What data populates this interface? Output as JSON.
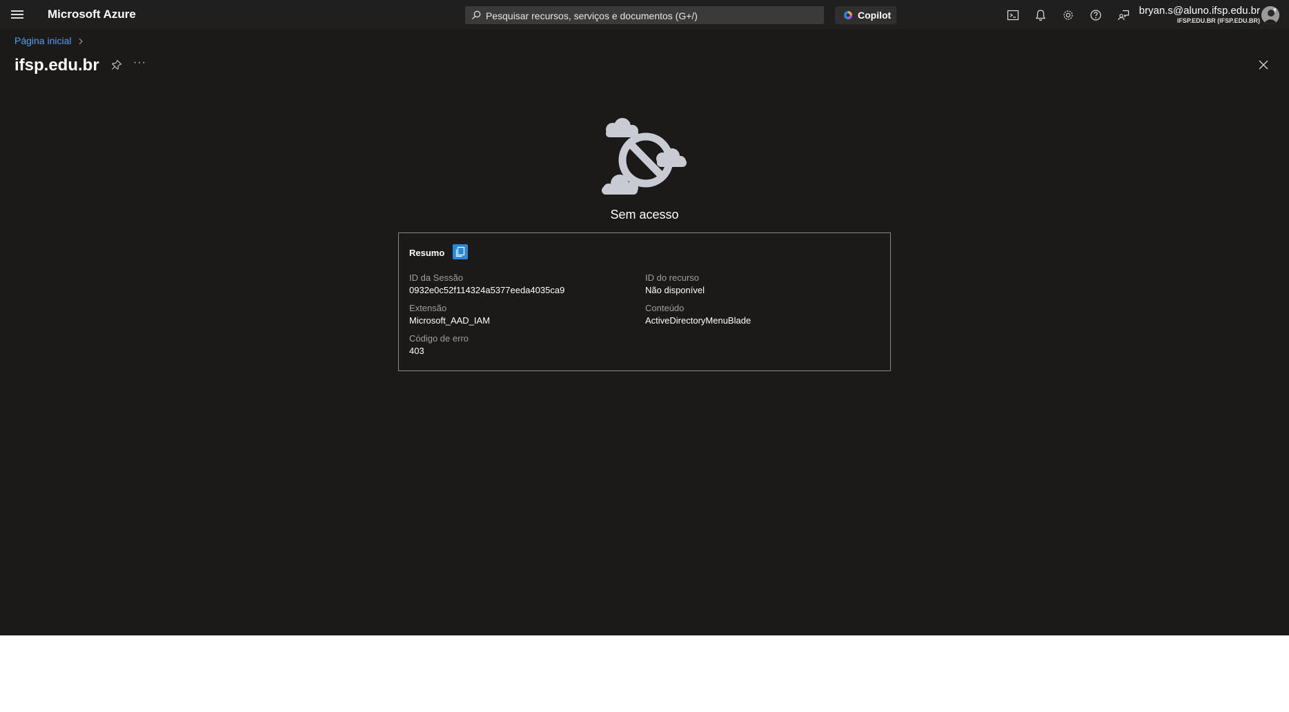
{
  "header": {
    "brand": "Microsoft Azure",
    "search_placeholder": "Pesquisar recursos, serviços e documentos (G+/)",
    "copilot_label": "Copilot",
    "account_email": "bryan.s@aluno.ifsp.edu.br",
    "account_tenant": "IFSP.EDU.BR (IFSP.EDU.BR)",
    "icons": [
      "cloud-shell-icon",
      "bell-icon",
      "gear-icon",
      "help-icon",
      "feedback-icon"
    ]
  },
  "breadcrumb": {
    "home": "Página inicial"
  },
  "page": {
    "title": "ifsp.edu.br",
    "more": "···"
  },
  "error": {
    "title": "Sem acesso",
    "summary_title": "Resumo",
    "fields": {
      "session_label": "ID da Sessão",
      "session_value": "0932e0c52f114324a5377eeda4035ca9",
      "resource_label": "ID do recurso",
      "resource_value": "Não disponível",
      "extension_label": "Extensão",
      "extension_value": "Microsoft_AAD_IAM",
      "content_label": "Conteúdo",
      "content_value": "ActiveDirectoryMenuBlade",
      "code_label": "Código de erro",
      "code_value": "403"
    }
  },
  "colors": {
    "background": "#1b1a19",
    "topbar": "#1f1f1f",
    "link": "#4ea1f3",
    "accent": "#2b88d8",
    "illustration": "#c8ccd2"
  }
}
